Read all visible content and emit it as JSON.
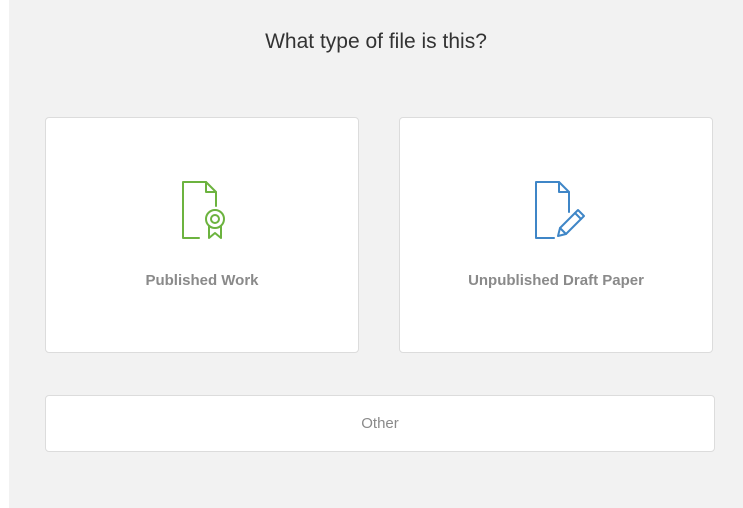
{
  "dialog": {
    "title": "What type of file is this?"
  },
  "options": [
    {
      "label": "Published Work",
      "icon": "certified-document-icon",
      "color": "#6cb33f"
    },
    {
      "label": "Unpublished Draft Paper",
      "icon": "document-edit-icon",
      "color": "#3f86c7"
    }
  ],
  "other": {
    "label": "Other"
  }
}
